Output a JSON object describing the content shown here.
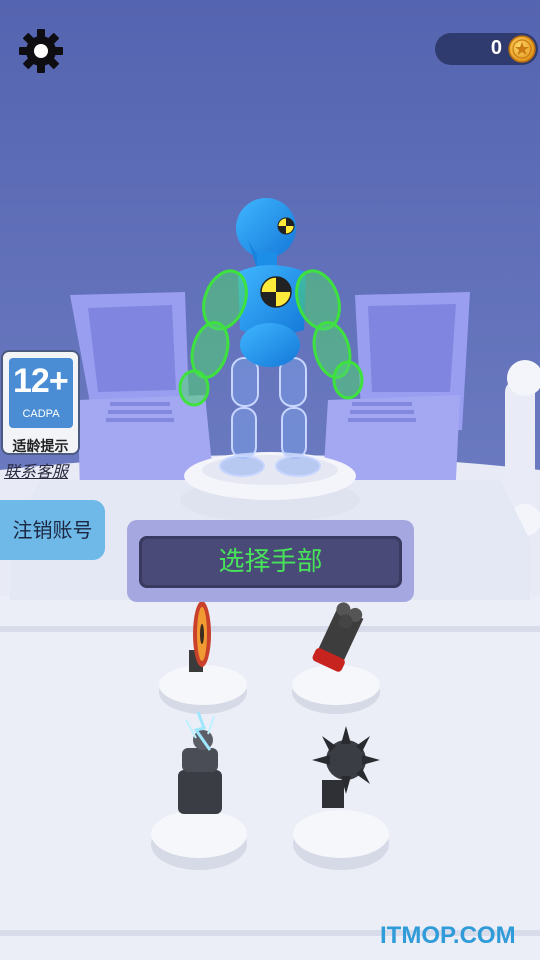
{
  "hud": {
    "coins": "0",
    "settings_icon": "gear-icon",
    "coin_icon": "coin-icon"
  },
  "age_rating": {
    "age": "12+",
    "org": "CADPA",
    "tip": "适龄提示"
  },
  "links": {
    "contact": "联系客服",
    "logout": "注销账号"
  },
  "panel": {
    "title": "选择手部"
  },
  "watermark": "ITMOP.COM",
  "colors": {
    "background": "#5b6ab6",
    "robot": "#1e9af0",
    "highlight": "#3ee23e",
    "title_text": "#47e45a"
  },
  "items": [
    {
      "name": "saw-blade-hand"
    },
    {
      "name": "gatling-hand"
    },
    {
      "name": "tesla-coil-hand"
    },
    {
      "name": "spiked-mace-hand"
    }
  ]
}
